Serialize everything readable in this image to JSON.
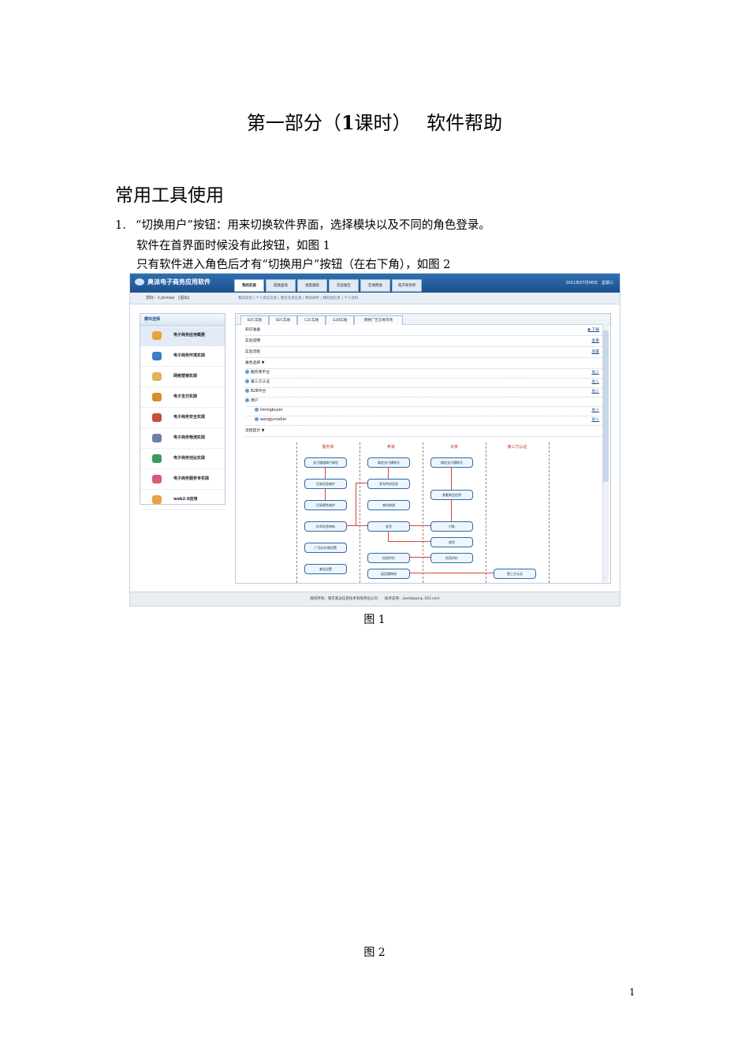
{
  "heading": {
    "title_a": "第一部分（",
    "title_b": "1",
    "title_c": "课时）　 软件帮助"
  },
  "section": "常用工具使用",
  "item1": {
    "num": "1.",
    "line1": "“切换用户”按钮：用来切换软件界面，选择模块以及不同的角色登录。",
    "line2": "软件在首界面时候没有此按钮，如图 1",
    "line3": "只有软件进入角色后才有“切换用户”按钮（在右下角），如图 2"
  },
  "fig1_caption": "图 1",
  "fig2_caption": "图 2",
  "page_number": "1",
  "screenshot": {
    "logo": "奥派电子商务应用软件",
    "tabs": [
      "我的实验",
      "成绩查询",
      "进度跟踪",
      "实验报告",
      "在线帮助",
      "电子商务师"
    ],
    "date": "2011年07月06日　星期三",
    "user": "您好：li.jinmao　[退出]",
    "sublinks": "我的实验 | 个人资信信息 | 我在任务信息 | 我的邮件 | 我的短信息 | 个人资料",
    "left_head": "模块选择",
    "modules": [
      "电子商务应用概要",
      "电子商务环境实践",
      "网络营销实践",
      "电子支付实践",
      "电子商务安全实践",
      "电子商务物流实践",
      "电子商务创业实践",
      "电子商务服务专实践",
      "web2.0应用"
    ],
    "right_tabs": [
      "B2C实践",
      "B2C实践",
      "C2C实践",
      "G2B实践",
      "网络广告交易市场"
    ],
    "rows": [
      {
        "label": "知识准备",
        "action": "◆ 下载"
      },
      {
        "label": "实验说明",
        "action": "查看"
      },
      {
        "label": "实验流程",
        "action": "放置"
      },
      {
        "label": "角色选择 ▼",
        "action": ""
      },
      {
        "label": "服务商平台",
        "action": "进入"
      },
      {
        "label": "第三方认证",
        "action": "进入"
      },
      {
        "label": "B2B平台",
        "action": "进入"
      },
      {
        "label": "用户",
        "action": ""
      },
      {
        "label": "limingbuyer",
        "action": "进入"
      },
      {
        "label": "wangjunseller",
        "action": "进入"
      },
      {
        "label": "流程提示 ▼",
        "action": ""
      }
    ],
    "lanes": [
      "服务商",
      "卖家",
      "买家",
      "第三方认证"
    ],
    "flow_boxes": [
      "支付通道商户绑定",
      "绑定支付通帐号",
      "绑定支付通帐号",
      "目录信息维护",
      "发布供求信息",
      "查看商品信息",
      "目录属性维护",
      "商机快递",
      "技术信息审核",
      "发货",
      "付款",
      "广告位价格设置",
      "收货",
      "信用评价",
      "信用评价",
      "查信设置",
      "返回通审核",
      "第三方认证"
    ],
    "footer": "版权所有：南京奥派信息技术有限责任公司　　技术支持：jiaolab@vip.163.com"
  }
}
